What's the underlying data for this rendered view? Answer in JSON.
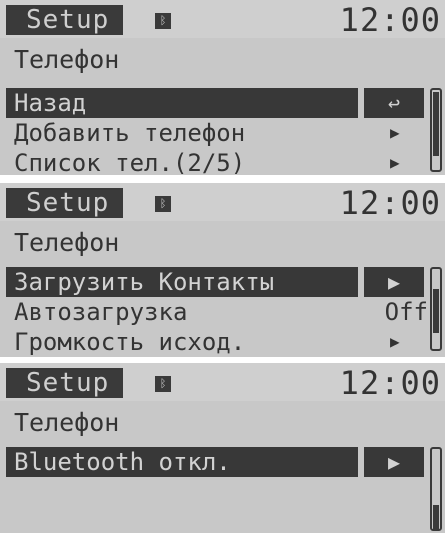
{
  "screens": [
    {
      "header": {
        "title": "Setup",
        "time": "12:00",
        "icon": "bluetooth-icon"
      },
      "subtitle": "Телефон",
      "items": [
        {
          "label": "Назад",
          "selected": true,
          "control": "↩"
        },
        {
          "label": "Добавить телефон",
          "control": "▶"
        },
        {
          "label": "Список тел.(2/5)",
          "control": "▶"
        }
      ],
      "scroll_position": 0.0
    },
    {
      "header": {
        "title": "Setup",
        "time": "12:00",
        "icon": "bluetooth-icon"
      },
      "subtitle": "Телефон",
      "items": [
        {
          "label": "Загрузить Контакты",
          "selected": true,
          "control": "▶"
        },
        {
          "label": "Автозагрузка",
          "value": "Off"
        },
        {
          "label": "Громкость исход.",
          "control": "▶"
        }
      ],
      "scroll_position": 0.45
    },
    {
      "header": {
        "title": "Setup",
        "time": "12:00",
        "icon": "bluetooth-icon"
      },
      "subtitle": "Телефон",
      "items": [
        {
          "label": "Bluetooth откл.",
          "selected": true,
          "control": "▶"
        }
      ],
      "scroll_position": 1.0
    }
  ],
  "colors": {
    "screen_bg": "#c8c8c8",
    "dark": "#383838",
    "text": "#333333",
    "inverted_text": "#d2d2d2"
  }
}
